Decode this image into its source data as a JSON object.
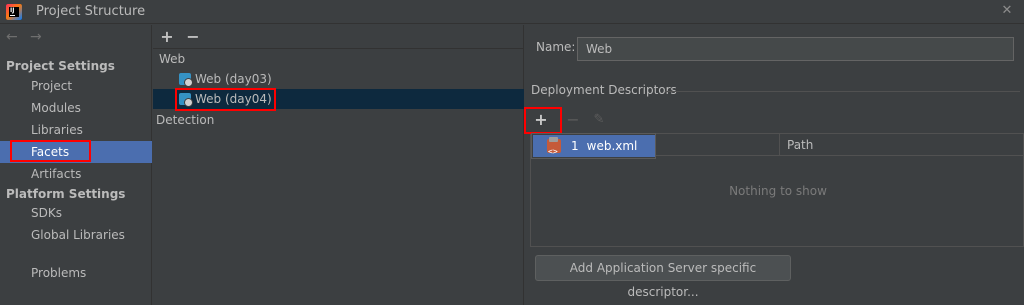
{
  "window": {
    "title": "Project Structure"
  },
  "sidebar": {
    "sections": [
      {
        "title": "Project Settings",
        "items": [
          "Project",
          "Modules",
          "Libraries",
          "Facets",
          "Artifacts"
        ]
      },
      {
        "title": "Platform Settings",
        "items": [
          "SDKs",
          "Global Libraries"
        ]
      }
    ],
    "problems": "Problems",
    "selected": "Facets"
  },
  "middle": {
    "tree": {
      "group": "Web",
      "items": [
        "Web (day03)",
        "Web (day04)"
      ],
      "selected": "Web (day04)",
      "detection": "Detection"
    }
  },
  "right": {
    "name_label": "Name:",
    "name_value": "Web",
    "descriptors_title": "Deployment Descriptors",
    "table": {
      "columns": [
        "",
        "Path"
      ],
      "empty": "Nothing to show"
    },
    "popup": {
      "number": "1",
      "label": "web.xml"
    },
    "add_server_button": "Add Application Server specific descriptor..."
  },
  "colors": {
    "background": "#3c3f41",
    "selection": "#4b6eaf",
    "tree_selection": "#0d293e",
    "highlight": "#ff0000"
  }
}
